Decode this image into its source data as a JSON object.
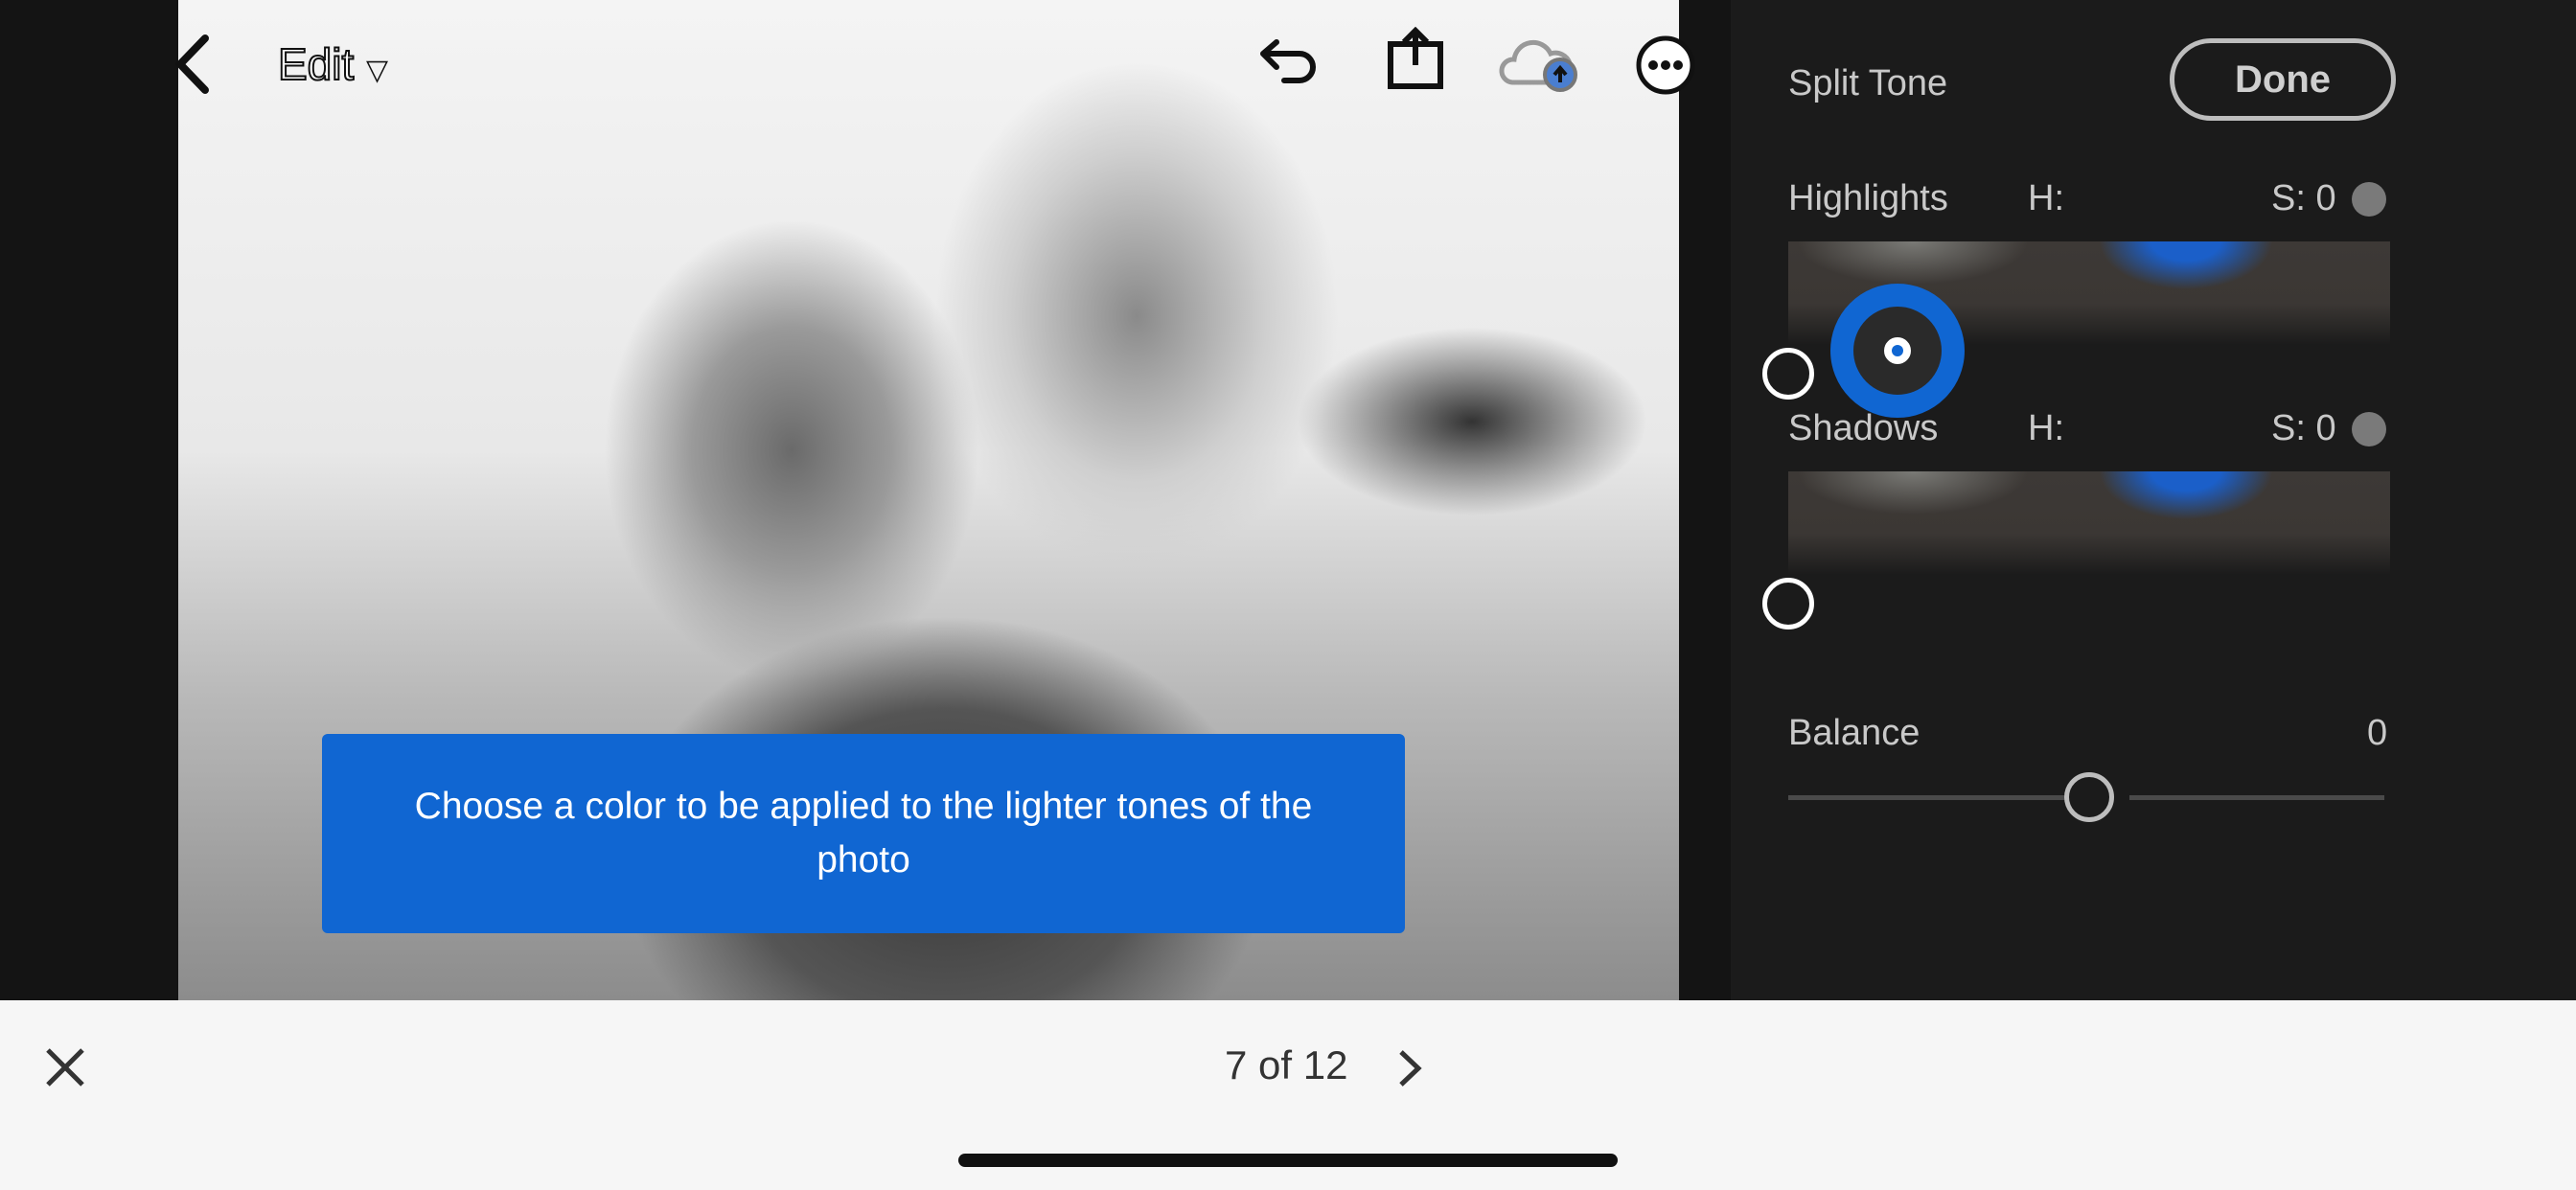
{
  "topbar": {
    "back_icon": "chevron-left-icon",
    "edit_label": "Edit",
    "edit_dropdown_icon": "triangle-down-icon",
    "undo_icon": "undo-icon",
    "share_icon": "share-icon",
    "cloud_icon": "cloud-upload-icon",
    "more_icon": "more-icon"
  },
  "tooltip": {
    "text": "Choose a color to be applied to the lighter tones of the photo"
  },
  "panel": {
    "title": "Split Tone",
    "done_label": "Done",
    "highlights": {
      "label": "Highlights",
      "hue_label": "H:",
      "sat_label": "S: 0"
    },
    "shadows": {
      "label": "Shadows",
      "hue_label": "H:",
      "sat_label": "S: 0"
    },
    "balance": {
      "label": "Balance",
      "value": "0",
      "level": 0
    },
    "accent_color": "#1066d2"
  },
  "bottombar": {
    "close_icon": "close-icon",
    "counter": "7 of 12",
    "next_icon": "chevron-right-icon"
  }
}
